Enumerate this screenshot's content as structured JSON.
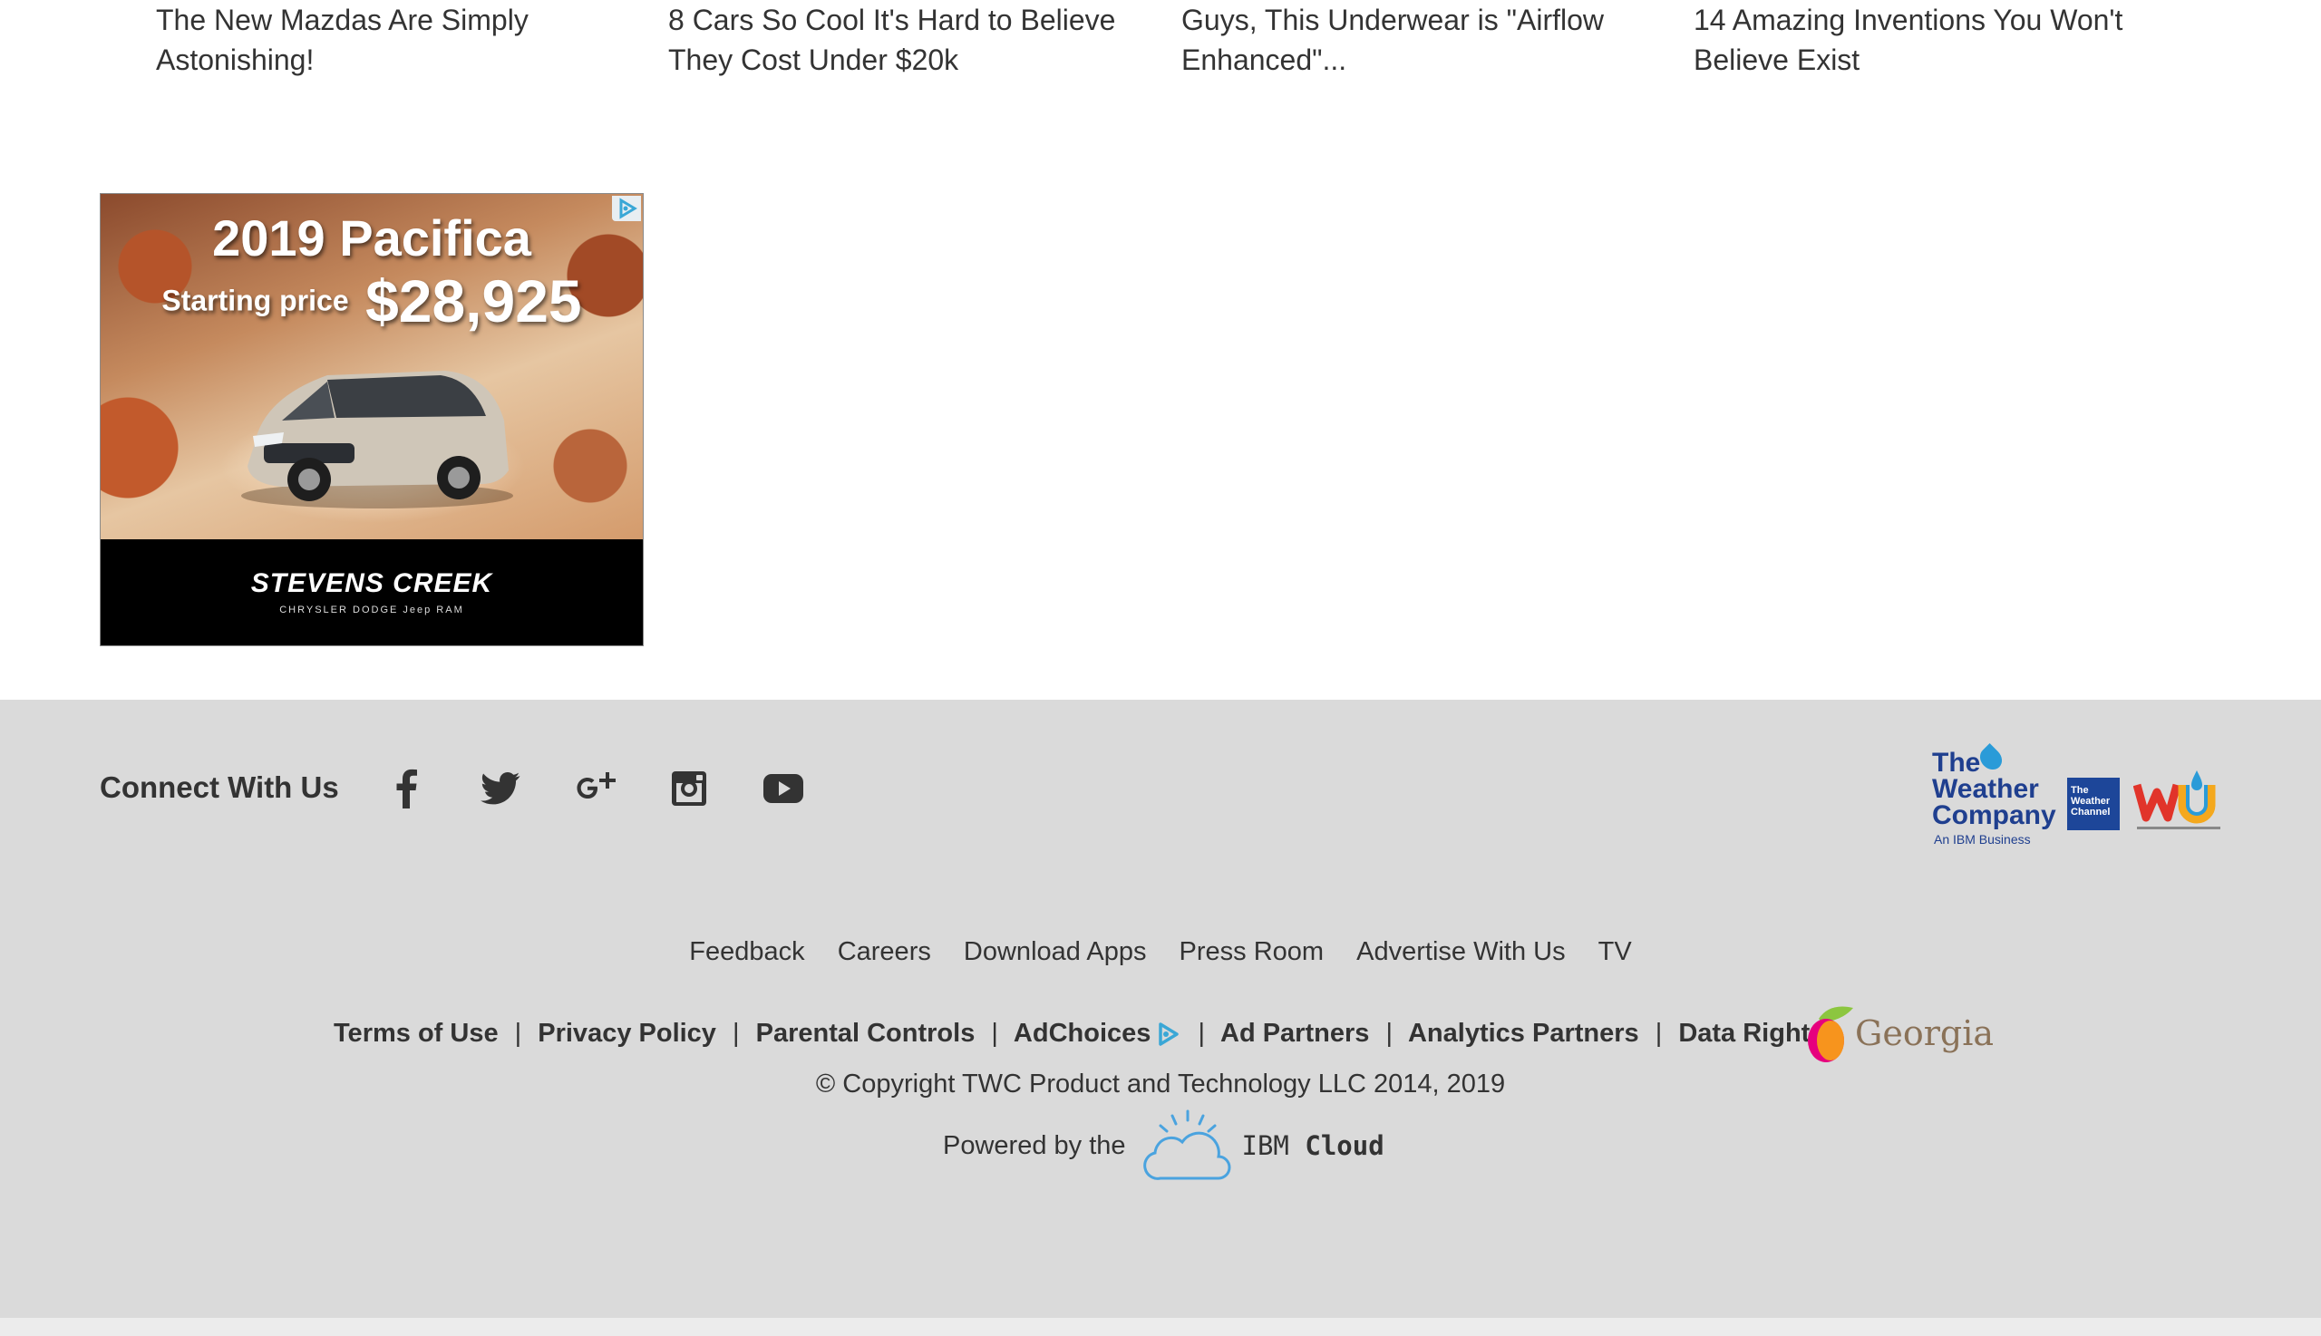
{
  "stories": [
    {
      "line1": "The New Mazdas Are Simply",
      "line2": "Astonishing!"
    },
    {
      "line1": "8 Cars So Cool It's Hard to Believe",
      "line2": "They Cost Under $20k"
    },
    {
      "line1": "Guys, This Underwear is \"Airflow",
      "line2": "Enhanced\"..."
    },
    {
      "line1": "14 Amazing Inventions You Won't",
      "line2": "Believe Exist"
    }
  ],
  "ad": {
    "title": "2019 Pacifica",
    "price_label": "Starting price",
    "price": "$28,925",
    "dealer": "STEVENS CREEK",
    "brands": "CHRYSLER  DODGE  Jeep  RAM",
    "adchoices_icon": "adchoices-triangle-icon"
  },
  "footer": {
    "connect_label": "Connect With Us",
    "social_icons": [
      "facebook-icon",
      "twitter-icon",
      "google-plus-icon",
      "instagram-icon",
      "youtube-icon"
    ],
    "brand_logos": {
      "twc_line1": "The",
      "twc_line2": "Weather",
      "twc_line3": "Company",
      "twc_sub": "An IBM Business",
      "channel_line1": "The",
      "channel_line2": "Weather",
      "channel_line3": "Channel"
    },
    "links": [
      "Feedback",
      "Careers",
      "Download Apps",
      "Press Room",
      "Advertise With Us",
      "TV"
    ],
    "legal": {
      "terms": "Terms of Use",
      "privacy": "Privacy Policy",
      "parental": "Parental Controls",
      "adchoices": "AdChoices",
      "ad_partners": "Ad Partners",
      "analytics": "Analytics Partners",
      "data_rights": "Data Rights",
      "separator": "|"
    },
    "georgia": "Georgia",
    "copyright": "© Copyright TWC Product and Technology LLC 2014, 2019",
    "powered_label": "Powered by the",
    "ibm": "IBM",
    "cloud": "Cloud"
  },
  "colors": {
    "footer_bg": "#dadada",
    "text": "#333333",
    "ibm_blue": "#4aa3df",
    "twc_navy": "#1f3f8f"
  }
}
